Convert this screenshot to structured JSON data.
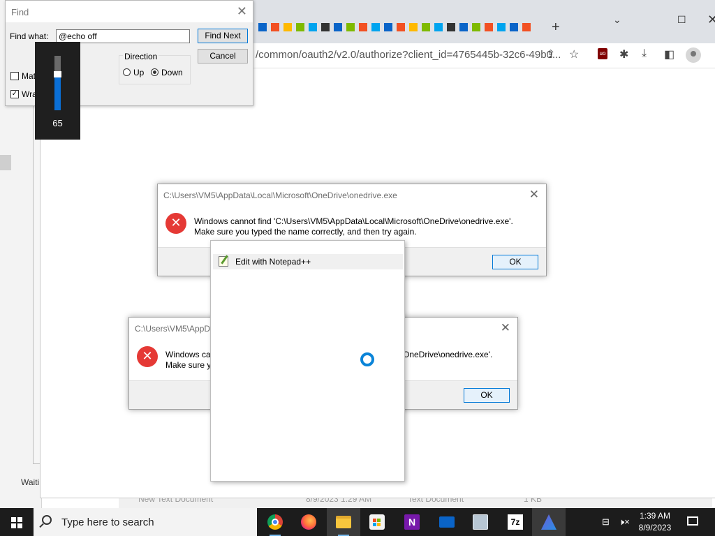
{
  "background": {
    "explorer_status": "Waiti",
    "list_row": {
      "name": "New Text Document",
      "date": "8/9/2023 1:29 AM",
      "type": "Text Document",
      "size": "1 KB"
    }
  },
  "browser": {
    "url": "/common/oauth2/v2.0/authorize?client_id=4765445b-32c6-49b0...",
    "new_tab_icon": "plus-icon",
    "colors": {
      "tabstrip": "#dee1e6"
    }
  },
  "find_dialog": {
    "title": "Find",
    "find_what_label": "Find what:",
    "find_what_value": "@echo off",
    "find_next_label": "Find Next",
    "cancel_label": "Cancel",
    "direction_label": "Direction",
    "up_label": "Up",
    "down_label": "Down",
    "direction_selected": "Down",
    "match_case_label": "Matc",
    "match_case_checked": false,
    "wrap_label": "Wra",
    "wrap_checked": true
  },
  "volume_overlay": {
    "value": "65",
    "level_percent": 65
  },
  "error_dialog_1": {
    "title": "C:\\Users\\VM5\\AppData\\Local\\Microsoft\\OneDrive\\onedrive.exe",
    "line1": "Windows cannot find 'C:\\Users\\VM5\\AppData\\Local\\Microsoft\\OneDrive\\onedrive.exe'.",
    "line2": "Make sure you typed the name correctly, and then try again.",
    "ok_label": "OK"
  },
  "error_dialog_2": {
    "title": "C:\\Users\\VM5\\AppD",
    "line1_start": "Windows ca",
    "line1_end": "OneDrive\\onedrive.exe'.",
    "line2_start": "Make sure y",
    "ok_label": "OK"
  },
  "context_menu": {
    "item_label": "Edit with Notepad++",
    "item_icon": "notepad-plus-plus-icon"
  },
  "taskbar": {
    "search_placeholder": "Type here to search",
    "apps": [
      "chrome",
      "firefox",
      "file-explorer",
      "microsoft-store",
      "onenote",
      "mail",
      "network-app",
      "7zip",
      "ai-app"
    ],
    "time": "1:39 AM",
    "date": "8/9/2023"
  }
}
